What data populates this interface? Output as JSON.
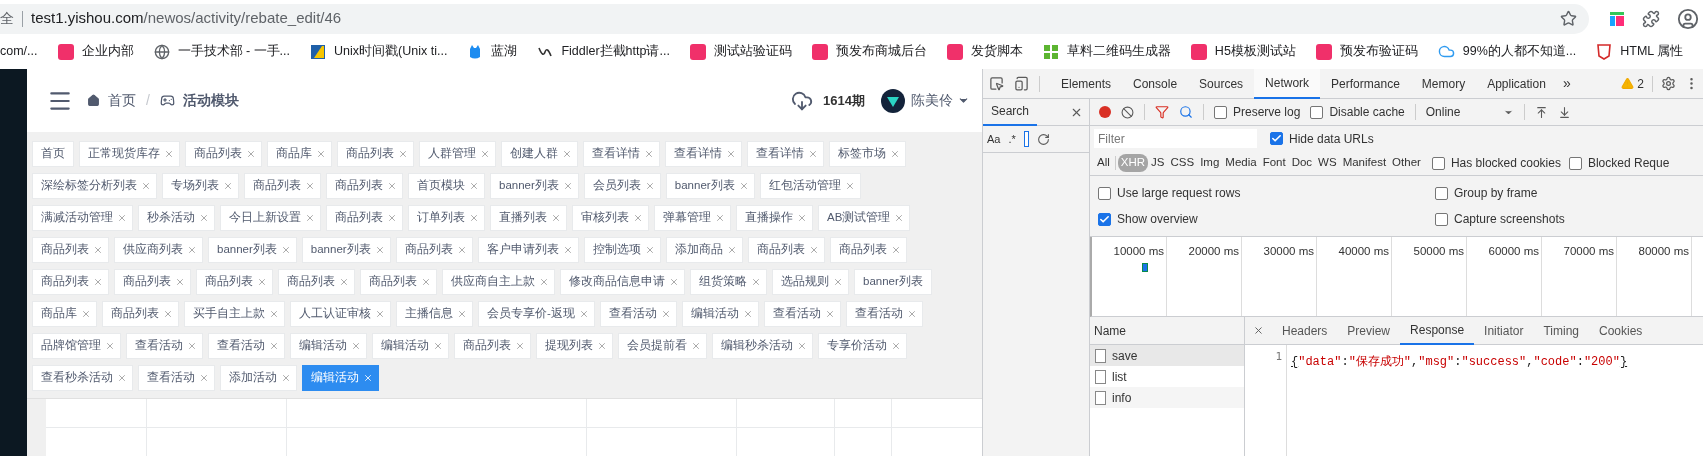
{
  "browser": {
    "address_prefix": "全",
    "url_host": "test1.yishou.com",
    "url_path": "/newos/activity/rebate_edit/46",
    "bookmarks": [
      {
        "label": "com/...",
        "kind": "none"
      },
      {
        "label": "企业内部",
        "kind": "brand"
      },
      {
        "label": "一手技术部 - 一手...",
        "kind": "globe"
      },
      {
        "label": "Unix时间戳(Unix ti...",
        "kind": "unix"
      },
      {
        "label": "蓝湖",
        "kind": "mascot"
      },
      {
        "label": "Fiddler拦截http请...",
        "kind": "fiddler"
      },
      {
        "label": "测试站验证码",
        "kind": "brand"
      },
      {
        "label": "预发布商城后台",
        "kind": "brand"
      },
      {
        "label": "发货脚本",
        "kind": "brand"
      },
      {
        "label": "草料二维码生成器",
        "kind": "grid"
      },
      {
        "label": "H5模板测试站",
        "kind": "brand"
      },
      {
        "label": "预发布验证码",
        "kind": "brand"
      },
      {
        "label": "99%的人都不知道...",
        "kind": "cloud"
      },
      {
        "label": "HTML 属性",
        "kind": "shield"
      }
    ]
  },
  "app": {
    "breadcrumbs": [
      {
        "label": "首页",
        "current": false
      },
      {
        "label": "活动模块",
        "current": true
      }
    ],
    "breadcrumb_separator": "/",
    "period": "1614期",
    "user": "陈美伶",
    "tag_rows": [
      [
        {
          "label": "首页",
          "closable": false,
          "selected": false
        },
        {
          "label": "正常现货库存",
          "closable": true,
          "selected": false
        },
        {
          "label": "商品列表",
          "closable": true,
          "selected": false
        },
        {
          "label": "商品库",
          "closable": true,
          "selected": false
        },
        {
          "label": "商品列表",
          "closable": true,
          "selected": false
        },
        {
          "label": "人群管理",
          "closable": true,
          "selected": false
        },
        {
          "label": "创建人群",
          "closable": true,
          "selected": false
        },
        {
          "label": "查看详情",
          "closable": true,
          "selected": false
        },
        {
          "label": "查看详情",
          "closable": true,
          "selected": false
        },
        {
          "label": "查看详情",
          "closable": true,
          "selected": false
        },
        {
          "label": "标签市场",
          "closable": true,
          "selected": false
        }
      ],
      [
        {
          "label": "深绘标签分析列表",
          "closable": true,
          "selected": false
        },
        {
          "label": "专场列表",
          "closable": true,
          "selected": false
        },
        {
          "label": "商品列表",
          "closable": true,
          "selected": false
        },
        {
          "label": "商品列表",
          "closable": true,
          "selected": false
        },
        {
          "label": "首页模块",
          "closable": true,
          "selected": false
        },
        {
          "label": "banner列表",
          "closable": true,
          "selected": false
        },
        {
          "label": "会员列表",
          "closable": true,
          "selected": false
        },
        {
          "label": "banner列表",
          "closable": true,
          "selected": false
        },
        {
          "label": "红包活动管理",
          "closable": true,
          "selected": false
        }
      ],
      [
        {
          "label": "满减活动管理",
          "closable": true,
          "selected": false
        },
        {
          "label": "秒杀活动",
          "closable": true,
          "selected": false
        },
        {
          "label": "今日上新设置",
          "closable": true,
          "selected": false
        },
        {
          "label": "商品列表",
          "closable": true,
          "selected": false
        },
        {
          "label": "订单列表",
          "closable": true,
          "selected": false
        },
        {
          "label": "直播列表",
          "closable": true,
          "selected": false
        },
        {
          "label": "审核列表",
          "closable": true,
          "selected": false
        },
        {
          "label": "弹幕管理",
          "closable": true,
          "selected": false
        },
        {
          "label": "直播操作",
          "closable": true,
          "selected": false
        },
        {
          "label": "AB测试管理",
          "closable": true,
          "selected": false
        }
      ],
      [
        {
          "label": "商品列表",
          "closable": true,
          "selected": false
        },
        {
          "label": "供应商列表",
          "closable": true,
          "selected": false
        },
        {
          "label": "banner列表",
          "closable": true,
          "selected": false
        },
        {
          "label": "banner列表",
          "closable": true,
          "selected": false
        },
        {
          "label": "商品列表",
          "closable": true,
          "selected": false
        },
        {
          "label": "客户申请列表",
          "closable": true,
          "selected": false
        },
        {
          "label": "控制选项",
          "closable": true,
          "selected": false
        },
        {
          "label": "添加商品",
          "closable": true,
          "selected": false
        },
        {
          "label": "商品列表",
          "closable": true,
          "selected": false
        },
        {
          "label": "商品列表",
          "closable": true,
          "selected": false
        }
      ],
      [
        {
          "label": "商品列表",
          "closable": true,
          "selected": false
        },
        {
          "label": "商品列表",
          "closable": true,
          "selected": false
        },
        {
          "label": "商品列表",
          "closable": true,
          "selected": false
        },
        {
          "label": "商品列表",
          "closable": true,
          "selected": false
        },
        {
          "label": "商品列表",
          "closable": true,
          "selected": false
        },
        {
          "label": "供应商自主上款",
          "closable": true,
          "selected": false
        },
        {
          "label": "修改商品信息申请",
          "closable": true,
          "selected": false
        },
        {
          "label": "组货策略",
          "closable": true,
          "selected": false
        },
        {
          "label": "选品规则",
          "closable": true,
          "selected": false
        },
        {
          "label": "banner列表",
          "closable": false,
          "selected": false
        }
      ],
      [
        {
          "label": "商品库",
          "closable": true,
          "selected": false
        },
        {
          "label": "商品列表",
          "closable": true,
          "selected": false
        },
        {
          "label": "买手自主上款",
          "closable": true,
          "selected": false
        },
        {
          "label": "人工认证审核",
          "closable": true,
          "selected": false
        },
        {
          "label": "主播信息",
          "closable": true,
          "selected": false
        },
        {
          "label": "会员专享价-返现",
          "closable": true,
          "selected": false
        },
        {
          "label": "查看活动",
          "closable": true,
          "selected": false
        },
        {
          "label": "编辑活动",
          "closable": true,
          "selected": false
        },
        {
          "label": "查看活动",
          "closable": true,
          "selected": false
        },
        {
          "label": "查看活动",
          "closable": true,
          "selected": false
        }
      ],
      [
        {
          "label": "品牌馆管理",
          "closable": true,
          "selected": false
        },
        {
          "label": "查看活动",
          "closable": true,
          "selected": false
        },
        {
          "label": "查看活动",
          "closable": true,
          "selected": false
        },
        {
          "label": "编辑活动",
          "closable": true,
          "selected": false
        },
        {
          "label": "编辑活动",
          "closable": true,
          "selected": false
        },
        {
          "label": "商品列表",
          "closable": true,
          "selected": false
        },
        {
          "label": "提现列表",
          "closable": true,
          "selected": false
        },
        {
          "label": "会员提前看",
          "closable": true,
          "selected": false
        },
        {
          "label": "编辑秒杀活动",
          "closable": true,
          "selected": false
        },
        {
          "label": "专享价活动",
          "closable": true,
          "selected": false
        }
      ],
      [
        {
          "label": "查看秒杀活动",
          "closable": true,
          "selected": false
        },
        {
          "label": "查看活动",
          "closable": true,
          "selected": false
        },
        {
          "label": "添加活动",
          "closable": true,
          "selected": false
        },
        {
          "label": "编辑活动",
          "closable": true,
          "selected": true
        }
      ]
    ]
  },
  "devtools": {
    "tabs": [
      {
        "label": "Elements",
        "selected": false
      },
      {
        "label": "Console",
        "selected": false
      },
      {
        "label": "Sources",
        "selected": false
      },
      {
        "label": "Network",
        "selected": true
      },
      {
        "label": "Performance",
        "selected": false
      },
      {
        "label": "Memory",
        "selected": false
      },
      {
        "label": "Application",
        "selected": false
      }
    ],
    "more": "»",
    "warnings": "2",
    "search_panel": {
      "title": "Search",
      "case_toggle": "Aa",
      "regex_toggle": ".*"
    },
    "preserve_log": {
      "label": "Preserve log",
      "checked": false
    },
    "disable_cache": {
      "label": "Disable cache",
      "checked": false
    },
    "throttling": "Online",
    "filter": {
      "placeholder": "Filter"
    },
    "hide_data_urls": {
      "label": "Hide data URLs",
      "checked": true
    },
    "types": [
      {
        "label": "All",
        "selected": false
      },
      {
        "label": "XHR",
        "selected": true
      },
      {
        "label": "JS",
        "selected": false
      },
      {
        "label": "CSS",
        "selected": false
      },
      {
        "label": "Img",
        "selected": false
      },
      {
        "label": "Media",
        "selected": false
      },
      {
        "label": "Font",
        "selected": false
      },
      {
        "label": "Doc",
        "selected": false
      },
      {
        "label": "WS",
        "selected": false
      },
      {
        "label": "Manifest",
        "selected": false
      },
      {
        "label": "Other",
        "selected": false
      }
    ],
    "has_blocked_cookies": {
      "label": "Has blocked cookies",
      "checked": false
    },
    "blocked_requests": {
      "label": "Blocked Reque",
      "checked": false
    },
    "options": [
      {
        "label": "Use large request rows",
        "checked": false
      },
      {
        "label": "Group by frame",
        "checked": false
      },
      {
        "label": "Show overview",
        "checked": true
      },
      {
        "label": "Capture screenshots",
        "checked": false
      }
    ],
    "overview_ticks": [
      "10000 ms",
      "20000 ms",
      "30000 ms",
      "40000 ms",
      "50000 ms",
      "60000 ms",
      "70000 ms",
      "80000 ms"
    ],
    "name_header": "Name",
    "requests": [
      {
        "name": "save",
        "selected": true
      },
      {
        "name": "list",
        "selected": false
      },
      {
        "name": "info",
        "selected": false
      }
    ],
    "detail_tabs": [
      {
        "label": "Headers",
        "selected": false
      },
      {
        "label": "Preview",
        "selected": false
      },
      {
        "label": "Response",
        "selected": true
      },
      {
        "label": "Initiator",
        "selected": false
      },
      {
        "label": "Timing",
        "selected": false
      },
      {
        "label": "Cookies",
        "selected": false
      }
    ],
    "response": {
      "line_number": "1",
      "tokens": [
        {
          "text": "{",
          "kind": "bracket"
        },
        {
          "text": "\"data\"",
          "kind": "string"
        },
        {
          "text": ":",
          "kind": "punct"
        },
        {
          "text": "\"保存成功\"",
          "kind": "string"
        },
        {
          "text": ",",
          "kind": "punct"
        },
        {
          "text": "\"msg\"",
          "kind": "string"
        },
        {
          "text": ":",
          "kind": "punct"
        },
        {
          "text": "\"success\"",
          "kind": "string"
        },
        {
          "text": ",",
          "kind": "punct"
        },
        {
          "text": "\"code\"",
          "kind": "string"
        },
        {
          "text": ":",
          "kind": "punct"
        },
        {
          "text": "\"200\"",
          "kind": "string"
        },
        {
          "text": "}",
          "kind": "bracket"
        }
      ]
    }
  }
}
